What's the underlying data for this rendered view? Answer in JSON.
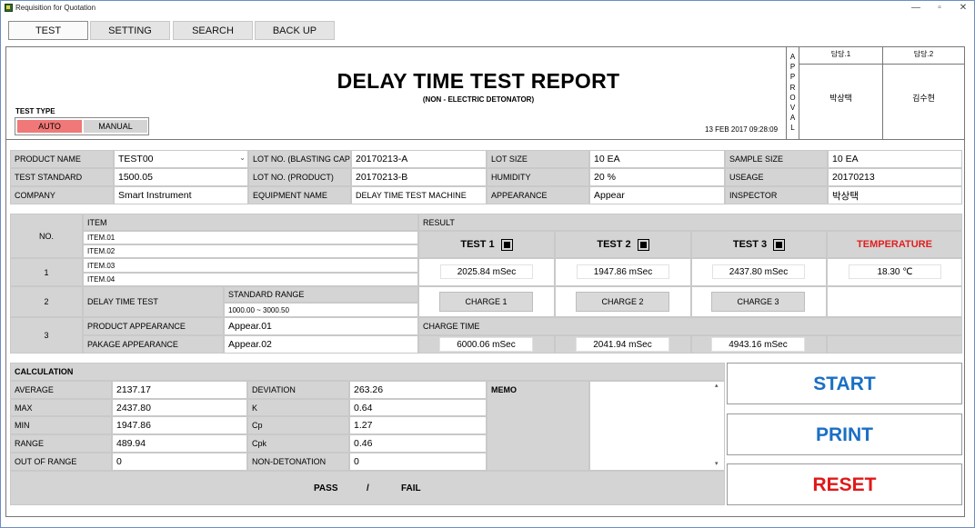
{
  "window": {
    "title": "Requisition for Quotation",
    "minimize": "—",
    "restore": "▫",
    "close": "✕"
  },
  "tabs": [
    {
      "label": "TEST",
      "active": true
    },
    {
      "label": "SETTING",
      "active": false
    },
    {
      "label": "SEARCH",
      "active": false
    },
    {
      "label": "BACK UP",
      "active": false
    }
  ],
  "report": {
    "title": "DELAY TIME TEST REPORT",
    "subtitle_pre": "(NON - ",
    "subtitle_post": "ELECTRIC DETONATOR)",
    "datetime": "13 FEB 2017 09:28:09",
    "test_type_label": "TEST TYPE",
    "auto_label": "AUTO",
    "manual_label": "MANUAL",
    "auto_color": "#f07878",
    "approval_letters": [
      "A",
      "P",
      "P",
      "R",
      "O",
      "V",
      "A",
      "L"
    ],
    "approver1_title": "담당.1",
    "approver2_title": "담당.2",
    "approver1_name": "박상택",
    "approver2_name": "김수현"
  },
  "info": {
    "product_name_label": "PRODUCT NAME",
    "product_name": "TEST00",
    "dropdown_icon": "chevron-down",
    "test_standard_label": "TEST STANDARD",
    "test_standard": "1500.05",
    "company_label": "COMPANY",
    "company": "Smart Instrument",
    "lot_blasting_label": "LOT NO. (BLASTING CAP)",
    "lot_blasting": "20170213-A",
    "lot_product_label": "LOT NO. (PRODUCT)",
    "lot_product": "20170213-B",
    "equipment_label": "EQUIPMENT NAME",
    "equipment": "DELAY TIME TEST MACHINE",
    "lot_size_label": "LOT SIZE",
    "lot_size": "10 EA",
    "humidity_label": "HUMIDITY",
    "humidity": "20 %",
    "appearance_label": "APPEARANCE",
    "appearance": "Appear",
    "sample_size_label": "SAMPLE SIZE",
    "sample_size": "10 EA",
    "useage_label": "USEAGE",
    "useage": "20170213",
    "inspector_label": "INSPECTOR",
    "inspector": "박상택"
  },
  "items": {
    "no_label": "NO.",
    "item_label": "ITEM",
    "result_label": "RESULT",
    "row1_no": "1",
    "row2_no": "2",
    "row3_no": "3",
    "item_list": [
      "ITEM.01",
      "ITEM.02",
      "ITEM.03",
      "ITEM.04"
    ],
    "delay_test_label": "DELAY TIME TEST",
    "standard_range_label": "STANDARD RANGE",
    "standard_range": "1000.00 ~ 3000.50",
    "product_appearance_label": "PRODUCT APPEARANCE",
    "product_appearance": "Appear.01",
    "package_appearance_label": "PAKAGE APPEARANCE",
    "package_appearance": "Appear.02",
    "test1_label": "TEST 1",
    "test2_label": "TEST 2",
    "test3_label": "TEST 3",
    "temperature_label": "TEMPERATURE",
    "temperature_color": "#e02020",
    "test1_value": "2025.84 mSec",
    "test2_value": "1947.86 mSec",
    "test3_value": "2437.80 mSec",
    "temperature_value": "18.30 ℃",
    "charge1_label": "CHARGE 1",
    "charge2_label": "CHARGE 2",
    "charge3_label": "CHARGE 3",
    "charge_time_label": "CHARGE TIME",
    "charge_time1": "6000.06 mSec",
    "charge_time2": "2041.94 mSec",
    "charge_time3": "4943.16 mSec"
  },
  "calc": {
    "title": "CALCULATION",
    "average_label": "AVERAGE",
    "average": "2137.17",
    "max_label": "MAX",
    "max": "2437.80",
    "min_label": "MIN",
    "min": "1947.86",
    "range_label": "RANGE",
    "range": "489.94",
    "out_of_range_label": "OUT OF RANGE",
    "out_of_range": "0",
    "deviation_label": "DEVIATION",
    "deviation": "263.26",
    "k_label": "K",
    "k": "0.64",
    "cp_label": "Cp",
    "cp": "1.27",
    "cpk_label": "Cpk",
    "cpk": "0.46",
    "non_detonation_label": "NON-DETONATION",
    "non_detonation": "0",
    "memo_label": "MEMO",
    "pass_label": "PASS",
    "slash": "/",
    "fail_label": "FAIL"
  },
  "actions": {
    "start_label": "START",
    "start_color": "#1a6fc4",
    "print_label": "PRINT",
    "print_color": "#1a6fc4",
    "reset_label": "RESET",
    "reset_color": "#e01818"
  }
}
